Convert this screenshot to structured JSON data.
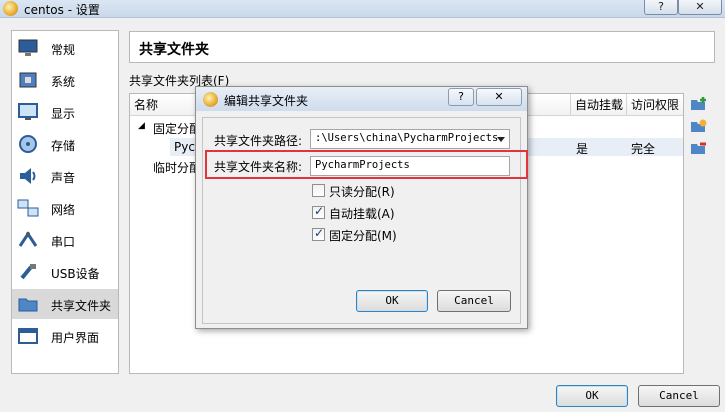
{
  "window": {
    "title": "centos - 设置",
    "help": "?",
    "close": "✕"
  },
  "nav": {
    "items": [
      {
        "label": "常规",
        "icon": "monitor-icon"
      },
      {
        "label": "系统",
        "icon": "chip-icon"
      },
      {
        "label": "显示",
        "icon": "display-icon"
      },
      {
        "label": "存储",
        "icon": "disk-icon"
      },
      {
        "label": "声音",
        "icon": "speaker-icon"
      },
      {
        "label": "网络",
        "icon": "network-icon"
      },
      {
        "label": "串口",
        "icon": "serial-icon"
      },
      {
        "label": "USB设备",
        "icon": "usb-icon"
      },
      {
        "label": "共享文件夹",
        "icon": "folder-icon"
      },
      {
        "label": "用户界面",
        "icon": "ui-icon"
      }
    ],
    "selected": "共享文件夹"
  },
  "main": {
    "title": "共享文件夹",
    "list_label": "共享文件夹列表(F)",
    "columns": {
      "name": "名称",
      "automount": "自动挂载",
      "access": "访问权限"
    },
    "tree": {
      "fixed_group": "固定分配",
      "fixed_item": "Pycharm",
      "fixed_item_automount": "是",
      "fixed_item_access": "完全",
      "temp_group": "临时分配"
    }
  },
  "footer": {
    "ok": "OK",
    "cancel": "Cancel"
  },
  "dialog": {
    "title": "编辑共享文件夹",
    "help": "?",
    "close": "✕",
    "path_label": "共享文件夹路径:",
    "path_value": ":\\Users\\china\\PycharmProjects",
    "name_label": "共享文件夹名称:",
    "name_value": "PycharmProjects",
    "readonly_label": "只读分配(R)",
    "readonly_checked": false,
    "automount_label": "自动挂载(A)",
    "automount_checked": true,
    "permanent_label": "固定分配(M)",
    "permanent_checked": true,
    "ok": "OK",
    "cancel": "Cancel"
  },
  "colors": {
    "highlight": "#e0353b",
    "selection": "#d9d9d9"
  }
}
